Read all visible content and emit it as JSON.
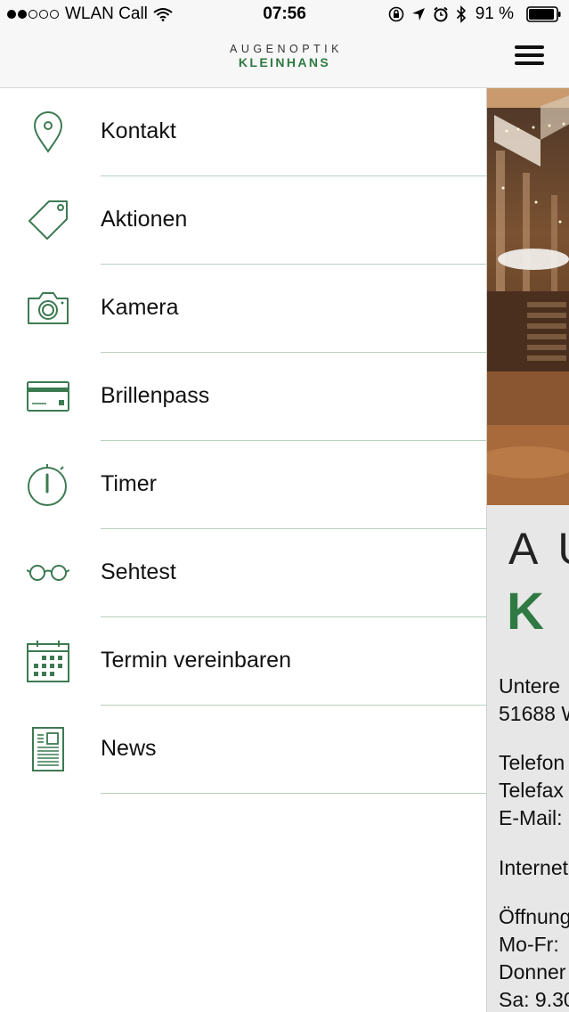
{
  "status_bar": {
    "carrier": "WLAN Call",
    "time": "07:56",
    "battery": "91 %"
  },
  "header": {
    "logo_top": "AUGENOPTIK",
    "logo_bottom": "KLEINHANS"
  },
  "menu": {
    "items": [
      {
        "label": "Kontakt",
        "icon": "location-pin-icon"
      },
      {
        "label": "Aktionen",
        "icon": "price-tag-icon"
      },
      {
        "label": "Kamera",
        "icon": "camera-icon"
      },
      {
        "label": "Brillenpass",
        "icon": "credit-card-icon"
      },
      {
        "label": "Timer",
        "icon": "stopwatch-icon"
      },
      {
        "label": "Sehtest",
        "icon": "glasses-icon"
      },
      {
        "label": "Termin vereinbaren",
        "icon": "calendar-icon"
      },
      {
        "label": "News",
        "icon": "newspaper-icon"
      }
    ]
  },
  "content": {
    "brand_top": "AU",
    "brand_bottom": "K",
    "address_lines": [
      "Untere",
      "51688 W"
    ],
    "contact_lines": [
      "Telefon",
      "Telefax",
      "E-Mail:"
    ],
    "internet_line": "Internet",
    "hours_lines": [
      "Öffnung",
      "Mo-Fr:",
      "Donner",
      "Sa: 9.30"
    ]
  },
  "colors": {
    "accent": "#2e7a42",
    "icon_stroke": "#3d7a52",
    "divider": "#b9d0bf"
  }
}
